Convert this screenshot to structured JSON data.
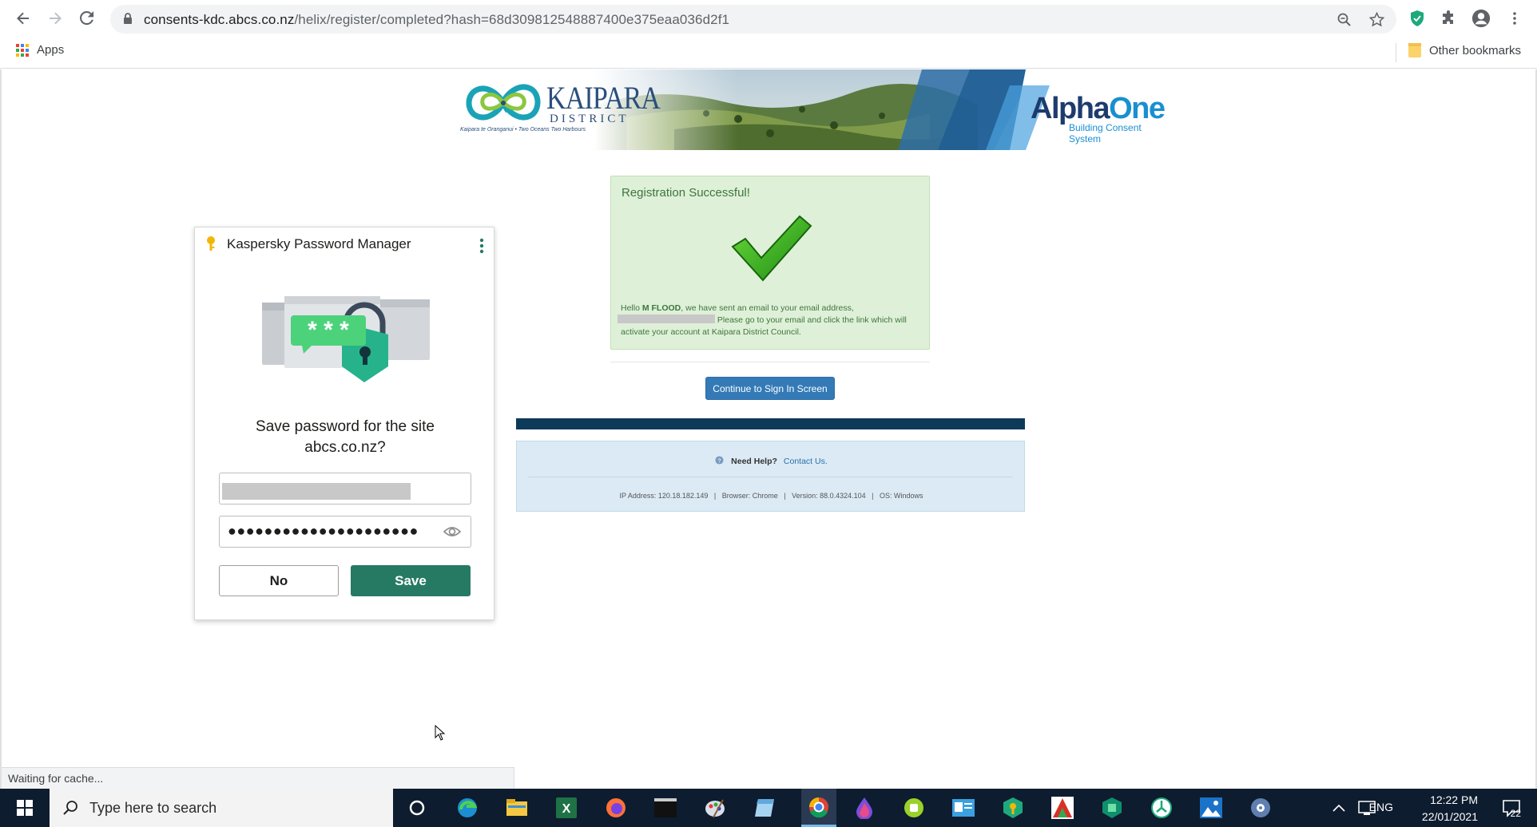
{
  "browser": {
    "url_host": "consents-kdc.abcs.co.nz",
    "url_path": "/helix/register/completed?hash=68d309812548887400e375eaa036d2f1",
    "bookmarks": {
      "apps_label": "Apps",
      "other_label": "Other bookmarks"
    },
    "status_text": "Waiting for cache..."
  },
  "banner": {
    "kaipara_title": "KAIPARA",
    "kaipara_district": "DISTRICT",
    "kaipara_tagline": "Kaipara te Oranganui • Two Oceans Two Harbours",
    "alpha_main": "Alpha",
    "alpha_one": "One",
    "alpha_sub": "Building Consent System"
  },
  "success": {
    "title": "Registration Successful!",
    "hello": "Hello ",
    "name": "M FLOOD",
    "msg_part1": ", we have sent an email to your email address,",
    "msg_part2": " Please go to your email and click the link which will activate your account at Kaipara District Council."
  },
  "continue_label": "Continue to Sign In Screen",
  "help": {
    "need_help": "Need Help?",
    "contact": "Contact Us.",
    "info": "IP Address: 120.18.182.149   |   Browser: Chrome   |   Version: 88.0.4324.104   |   OS: Windows"
  },
  "kaspersky": {
    "title": "Kaspersky Password Manager",
    "question": "Save password for the site abcs.co.nz?",
    "password_mask": "●●●●●●●●●●●●●●●●●●●●●",
    "no_label": "No",
    "save_label": "Save"
  },
  "taskbar": {
    "search_placeholder": "Type here to search",
    "lang": "ENG",
    "time": "12:22 PM",
    "date": "22/01/2021",
    "notification_count": "22"
  },
  "colors": {
    "kpm_green": "#267a63",
    "success_bg": "#dff0d8",
    "primary_btn": "#337ab7",
    "dark_bar": "#0e3a5a",
    "taskbar": "#0e1c2f"
  }
}
